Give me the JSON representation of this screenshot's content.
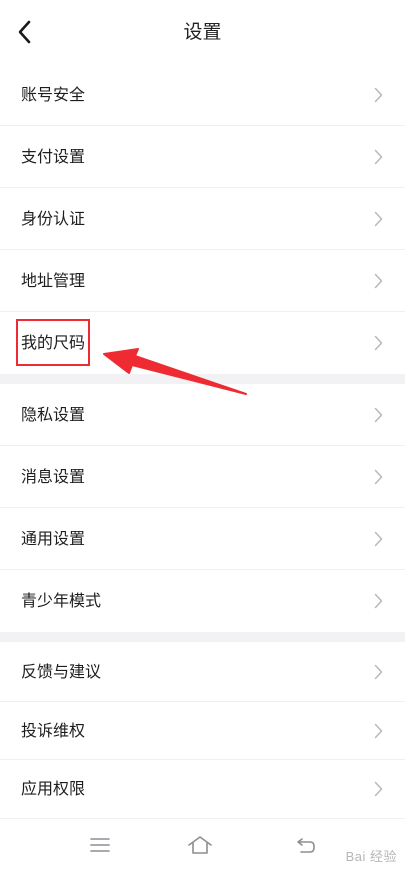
{
  "header": {
    "title": "设置",
    "back_icon": "chevron-left-icon"
  },
  "groups": [
    {
      "items": [
        {
          "label": "账号安全",
          "name": "account-security"
        },
        {
          "label": "支付设置",
          "name": "payment-settings"
        },
        {
          "label": "身份认证",
          "name": "identity-verification"
        },
        {
          "label": "地址管理",
          "name": "address-management"
        },
        {
          "label": "我的尺码",
          "name": "my-size"
        }
      ]
    },
    {
      "items": [
        {
          "label": "隐私设置",
          "name": "privacy-settings"
        },
        {
          "label": "消息设置",
          "name": "message-settings"
        },
        {
          "label": "通用设置",
          "name": "general-settings"
        },
        {
          "label": "青少年模式",
          "name": "teen-mode"
        }
      ]
    },
    {
      "items": [
        {
          "label": "反馈与建议",
          "name": "feedback"
        },
        {
          "label": "投诉维权",
          "name": "complaints"
        },
        {
          "label": "应用权限",
          "name": "app-permissions"
        }
      ]
    }
  ],
  "bottom_nav": {
    "menu_icon": "menu-icon",
    "home_icon": "home-icon",
    "back_icon": "back-icon"
  },
  "watermark": "Bai 经验",
  "colors": {
    "highlight": "#ee2b32",
    "separator": "#f2f2f4",
    "chevron": "#b8b8bd"
  }
}
